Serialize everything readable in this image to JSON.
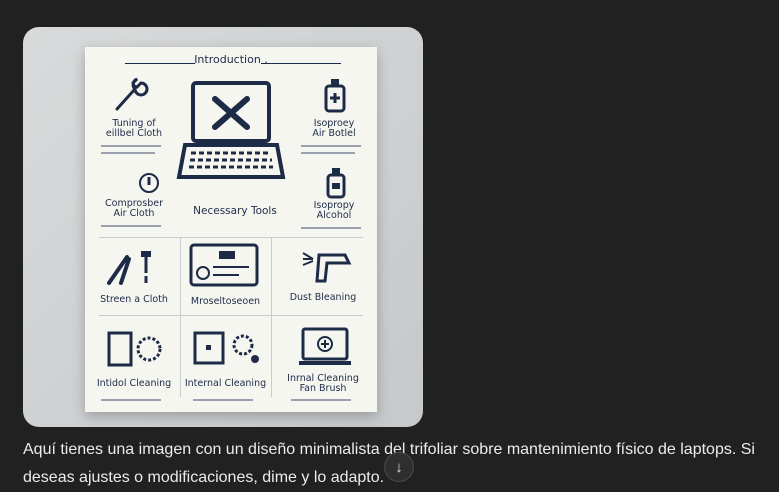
{
  "image": {
    "intro_title": "Introduction .",
    "labels": {
      "top_left": "Tuning of\neillbel Cloth",
      "top_right": "Isoproey\nAir Botlel",
      "mid_left": "Comprosber\nAir Cloth",
      "center": "Necessary Tools",
      "mid_right": "Isopropy\nAlcohol",
      "row3_left": "Streen a Cloth",
      "row3_mid": "Mroseltoseoen",
      "row3_right": "Dust Bleaning",
      "row4_left": "Intidol Cleaning",
      "row4_mid": "Internal Cleaning",
      "row4_right": "Inrnal Cleaning\nFan Brush"
    }
  },
  "message": {
    "text": "Aquí tienes una imagen con un diseño minimalista del trifoliar sobre mantenimiento físico de laptops. Si deseas ajustes o modificaciones, dime y lo adapto."
  },
  "scroll_icon": "arrow-down-icon"
}
